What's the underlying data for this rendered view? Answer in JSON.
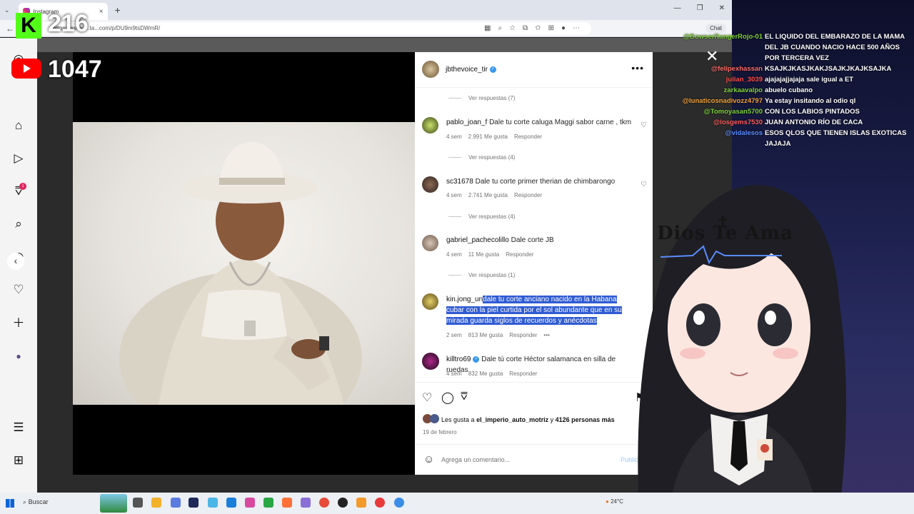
{
  "browser": {
    "tab_title": "Instagram",
    "url": "https://www.i...ta...com/p/DU9m9tsDWmR/",
    "chat_button": "Chat"
  },
  "stream": {
    "kick_count": "216",
    "youtube_count": "1047"
  },
  "post": {
    "author": "jbthevoice_tir",
    "comments": [
      {
        "user": "pablo_joan_f",
        "text": "Dale tu corte caluga Maggi sabor carne , tkm",
        "age": "4 sem",
        "likes": "2.991 Me gusta",
        "reply": "Responder",
        "replies": "Ver respuestas (4)"
      },
      {
        "user": "sc31678",
        "text": "Dale tu corte primer therian de chimbarongo",
        "age": "4 sem",
        "likes": "2.741 Me gusta",
        "reply": "Responder",
        "replies": "Ver respuestas (4)"
      },
      {
        "user": "gabriel_pachecolillo",
        "text": "Dale corte JB",
        "age": "4 sem",
        "likes": "11 Me gusta",
        "reply": "Responder",
        "replies": "Ver respuestas (1)"
      },
      {
        "user": "kin.jong_un",
        "text": "dale tu corte anciano nacido en la Habana cubar con la piel curtida por el sol abundante que en su mirada guarda siglos de recuerdos y anécdotas",
        "age": "2 sem",
        "likes": "813 Me gusta",
        "reply": "Responder"
      },
      {
        "user": "killtro69",
        "text": "Dale tú corte Héctor salamanca en silla de ruedas",
        "age": "4 sem",
        "likes": "832 Me gusta",
        "reply": "Responder"
      }
    ],
    "top_replies": "Ver respuestas (7)",
    "likes_prefix": "Les gusta a",
    "likes_user": "el_imperio_auto_motriz",
    "likes_mid": "y",
    "likes_rest": "4126 personas más",
    "date": "19 de febrero",
    "comment_placeholder": "Agrega un comentario...",
    "publish": "Publicar"
  },
  "chat": [
    {
      "name": "@BowserRangerRojo-01",
      "msg": "EL LIQUIDO DEL EMBARAZO DE LA MAMA DEL JB CUANDO NACIO HACE 500 AÑOS POR TERCERA VEZ",
      "color": "#7fd13b"
    },
    {
      "name": "@felipexhassan",
      "msg": "KSAJKJKASJKAKJSAJKJKAJKSAJKA",
      "color": "#ff6a6a"
    },
    {
      "name": "julian_3039",
      "msg": "ajajajajjajaja sale igual a ET",
      "color": "#ff4d4d"
    },
    {
      "name": "zarkaavalpo",
      "msg": "abuelo cubano",
      "color": "#7fd13b"
    },
    {
      "name": "@lunaticosnadivozz4797",
      "msg": "Ya estay insitando al odio ql",
      "color": "#f2a33a"
    },
    {
      "name": "@Tomoyasan5700",
      "msg": "CON LOS LABIOS PINTADOS",
      "color": "#7fd13b"
    },
    {
      "name": "@losgems7530",
      "msg": "JUAN ANTONIO RÍO DE CACA",
      "color": "#ff5e5e"
    },
    {
      "name": "@vidalesos",
      "msg": "ESOS QLOS QUE TIENEN ISLAS EXOTICAS JAJAJA",
      "color": "#5a8cff"
    }
  ],
  "overlay_text": "Dios Te Ama",
  "taskbar": {
    "search": "Buscar",
    "weather": "24°C"
  }
}
